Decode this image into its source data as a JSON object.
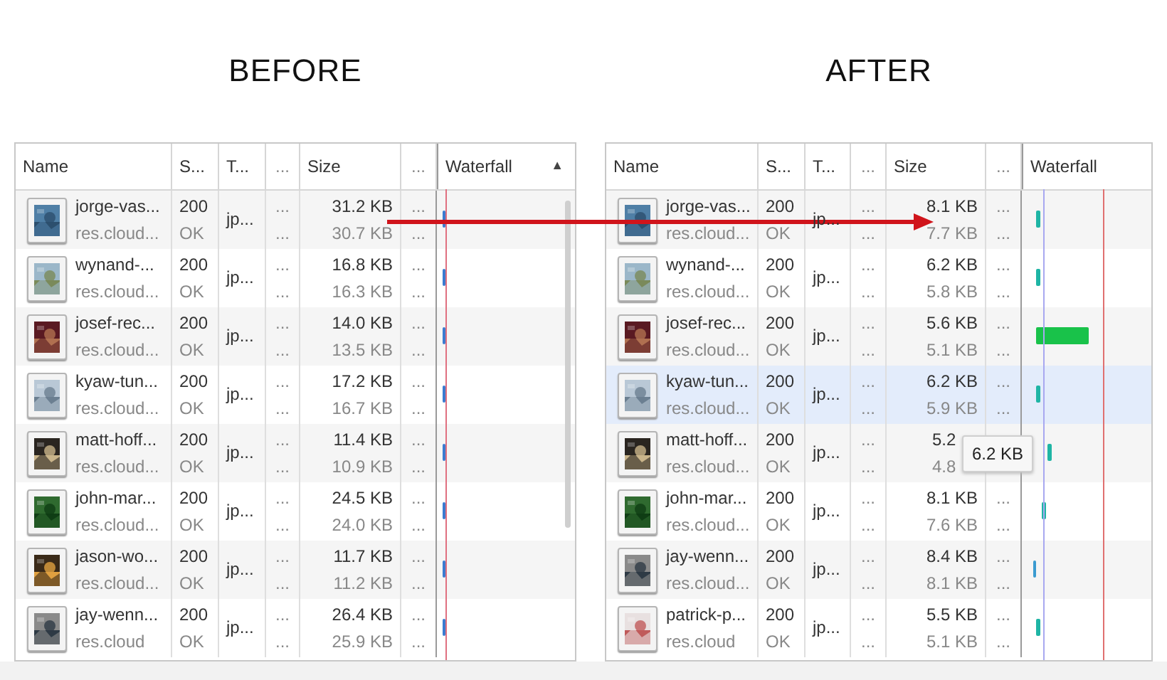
{
  "panels": [
    {
      "heading": "BEFORE",
      "columns": [
        "Name",
        "S...",
        "T...",
        "...",
        "Size",
        "...",
        "Waterfall"
      ],
      "sort_indicator": "▲",
      "rows": [
        {
          "name": "jorge-vas...",
          "domain": "res.cloud...",
          "status": "200",
          "status_text": "OK",
          "type": "jp...",
          "size": "31.2 KB",
          "resource": "30.7 KB",
          "hovered": false
        },
        {
          "name": "wynand-...",
          "domain": "res.cloud...",
          "status": "200",
          "status_text": "OK",
          "type": "jp...",
          "size": "16.8 KB",
          "resource": "16.3 KB",
          "hovered": false
        },
        {
          "name": "josef-rec...",
          "domain": "res.cloud...",
          "status": "200",
          "status_text": "OK",
          "type": "jp...",
          "size": "14.0 KB",
          "resource": "13.5 KB",
          "hovered": false
        },
        {
          "name": "kyaw-tun...",
          "domain": "res.cloud...",
          "status": "200",
          "status_text": "OK",
          "type": "jp...",
          "size": "17.2 KB",
          "resource": "16.7 KB",
          "hovered": false
        },
        {
          "name": "matt-hoff...",
          "domain": "res.cloud...",
          "status": "200",
          "status_text": "OK",
          "type": "jp...",
          "size": "11.4 KB",
          "resource": "10.9 KB",
          "hovered": false
        },
        {
          "name": "john-mar...",
          "domain": "res.cloud...",
          "status": "200",
          "status_text": "OK",
          "type": "jp...",
          "size": "24.5 KB",
          "resource": "24.0 KB",
          "hovered": false
        },
        {
          "name": "jason-wo...",
          "domain": "res.cloud...",
          "status": "200",
          "status_text": "OK",
          "type": "jp...",
          "size": "11.7 KB",
          "resource": "11.2 KB",
          "hovered": false
        },
        {
          "name": "jay-wenn...",
          "domain": "res.cloud",
          "status": "200",
          "status_text": "OK",
          "type": "jp...",
          "size": "26.4 KB",
          "resource": "25.9 KB",
          "hovered": false
        }
      ]
    },
    {
      "heading": "AFTER",
      "columns": [
        "Name",
        "S...",
        "T...",
        "...",
        "Size",
        "...",
        "Waterfall"
      ],
      "tooltip": "6.2 KB",
      "rows": [
        {
          "name": "jorge-vas...",
          "domain": "res.cloud...",
          "status": "200",
          "status_text": "OK",
          "type": "jp...",
          "size": "8.1 KB",
          "resource": "7.7 KB",
          "hovered": false
        },
        {
          "name": "wynand-...",
          "domain": "res.cloud...",
          "status": "200",
          "status_text": "OK",
          "type": "jp...",
          "size": "6.2 KB",
          "resource": "5.8 KB",
          "hovered": false
        },
        {
          "name": "josef-rec...",
          "domain": "res.cloud...",
          "status": "200",
          "status_text": "OK",
          "type": "jp...",
          "size": "5.6 KB",
          "resource": "5.1 KB",
          "hovered": false
        },
        {
          "name": "kyaw-tun...",
          "domain": "res.cloud...",
          "status": "200",
          "status_text": "OK",
          "type": "jp...",
          "size": "6.2 KB",
          "resource": "5.9 KB",
          "hovered": true
        },
        {
          "name": "matt-hoff...",
          "domain": "res.cloud...",
          "status": "200",
          "status_text": "OK",
          "type": "jp...",
          "size": "5.2",
          "resource": "4.8",
          "hovered": false
        },
        {
          "name": "john-mar...",
          "domain": "res.cloud...",
          "status": "200",
          "status_text": "OK",
          "type": "jp...",
          "size": "8.1 KB",
          "resource": "7.6 KB",
          "hovered": false
        },
        {
          "name": "jay-wenn...",
          "domain": "res.cloud...",
          "status": "200",
          "status_text": "OK",
          "type": "jp...",
          "size": "8.4 KB",
          "resource": "8.1 KB",
          "hovered": false
        },
        {
          "name": "patrick-p...",
          "domain": "res.cloud",
          "status": "200",
          "status_text": "OK",
          "type": "jp...",
          "size": "5.5 KB",
          "resource": "5.1 KB",
          "hovered": false
        }
      ]
    }
  ],
  "dots": "..."
}
